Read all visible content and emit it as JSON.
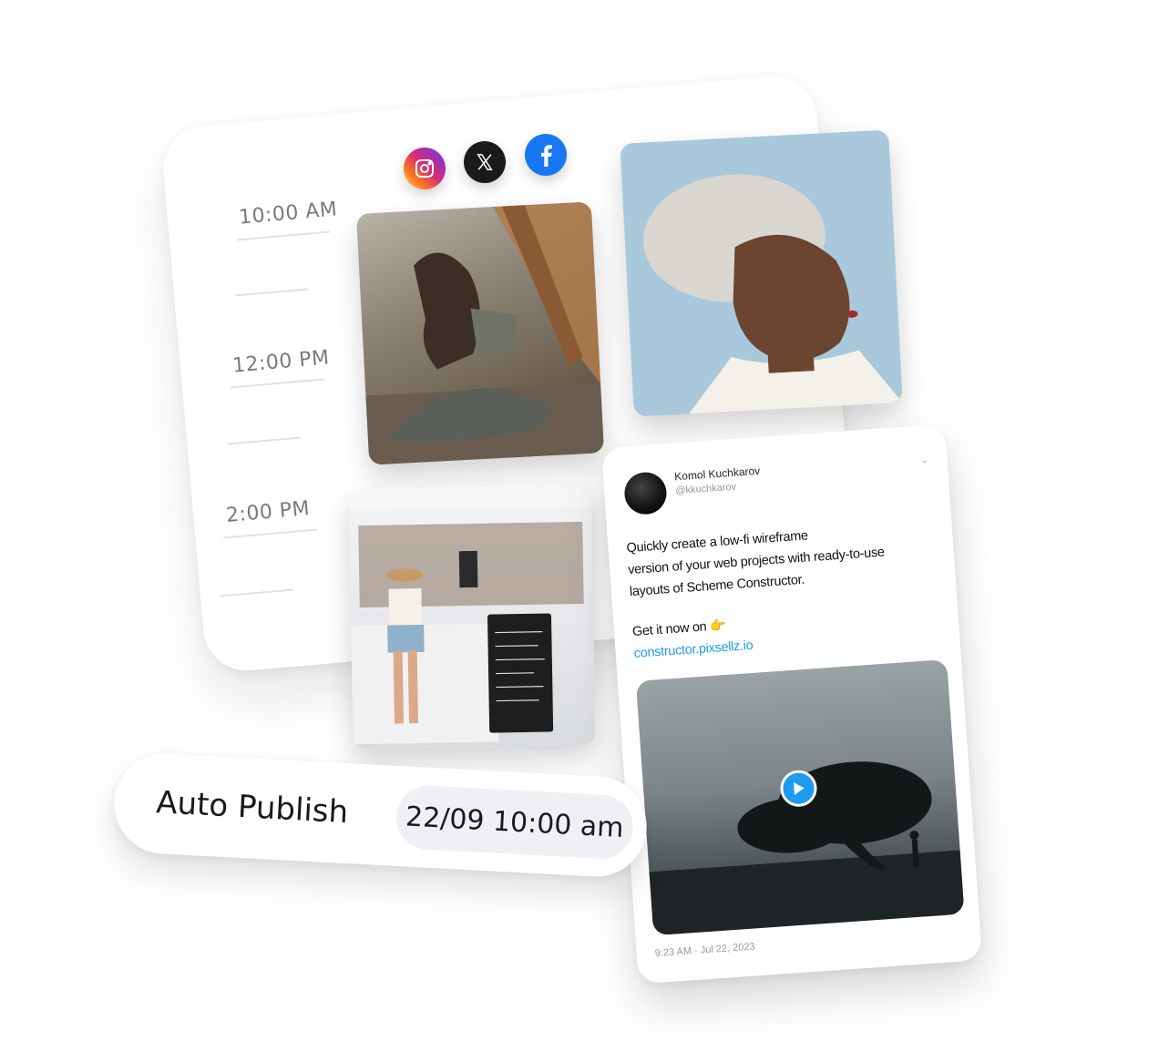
{
  "schedule": {
    "times": [
      "10:00 AM",
      "12:00 PM",
      "2:00 PM"
    ]
  },
  "social_icons": [
    "instagram-icon",
    "x-icon",
    "facebook-icon"
  ],
  "tweet": {
    "name": "Komol Kuchkarov",
    "handle": "@kkuchkarov",
    "body_lines": [
      "Quickly create a low-fi wireframe",
      "version of your web projects with ready-to-use",
      "layouts of Scheme Constructor."
    ],
    "cta": "Get it now on 👉",
    "link": "constructor.pixsellz.io",
    "timestamp": "9:23 AM · Jul 22, 2023"
  },
  "auto_publish": {
    "label": "Auto Publish",
    "datetime": "22/09 10:00 am"
  },
  "colors": {
    "facebook": "#1877f2",
    "x": "#1a1a1a",
    "link": "#1d9bf0"
  }
}
